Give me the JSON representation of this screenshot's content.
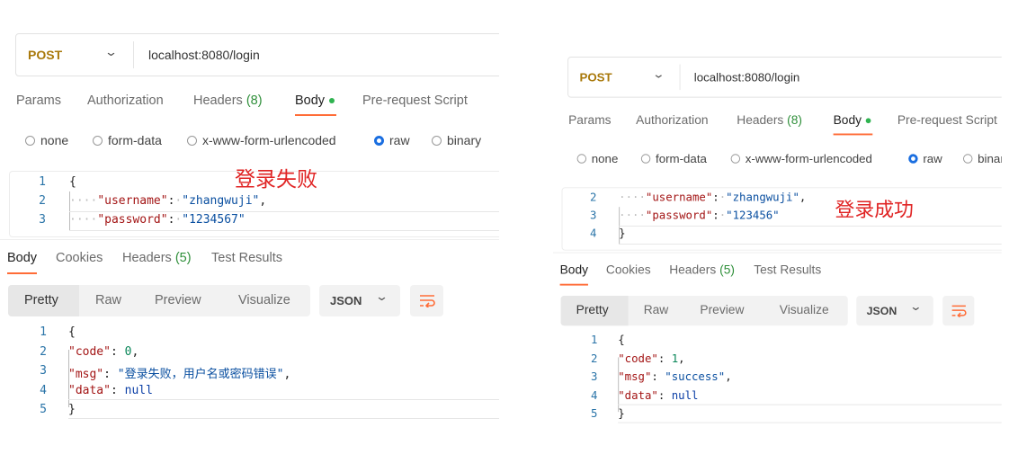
{
  "colors": {
    "accent": "#ff6c37",
    "method": "#a9790b",
    "annotation": "#e02424",
    "radio_selected": "#1a6ee0"
  },
  "panels": [
    {
      "method": "POST",
      "url": "localhost:8080/login",
      "request_tabs": [
        {
          "label": "Params"
        },
        {
          "label": "Authorization"
        },
        {
          "label": "Headers",
          "badge": "(8)"
        },
        {
          "label": "Body",
          "active": true,
          "dot": true
        },
        {
          "label": "Pre-request Script"
        }
      ],
      "body_types": [
        {
          "label": "none"
        },
        {
          "label": "form-data"
        },
        {
          "label": "x-www-form-urlencoded"
        },
        {
          "label": "raw",
          "selected": true
        },
        {
          "label": "binary"
        }
      ],
      "annotation": "登录失败",
      "request_lines": [
        {
          "n": "1",
          "tokens": [
            {
              "t": "{",
              "c": "p"
            }
          ]
        },
        {
          "n": "2",
          "tokens": [
            {
              "t": "····",
              "c": "w"
            },
            {
              "t": "\"username\"",
              "c": "k"
            },
            {
              "t": ":",
              "c": "p"
            },
            {
              "t": "·",
              "c": "w"
            },
            {
              "t": "\"zhangwuji\"",
              "c": "s"
            },
            {
              "t": ",",
              "c": "p"
            }
          ]
        },
        {
          "n": "3",
          "tokens": [
            {
              "t": "····",
              "c": "w"
            },
            {
              "t": "\"password\"",
              "c": "k"
            },
            {
              "t": ":",
              "c": "p"
            },
            {
              "t": "·",
              "c": "w"
            },
            {
              "t": "\"1234567\"",
              "c": "s"
            }
          ]
        }
      ],
      "response_tabs": [
        {
          "label": "Body",
          "active": true
        },
        {
          "label": "Cookies"
        },
        {
          "label": "Headers",
          "badge": "(5)"
        },
        {
          "label": "Test Results"
        }
      ],
      "view_modes": [
        "Pretty",
        "Raw",
        "Preview",
        "Visualize"
      ],
      "format": "JSON",
      "response_lines": [
        {
          "n": "1",
          "tokens": [
            {
              "t": "{",
              "c": "p"
            }
          ]
        },
        {
          "n": "2",
          "tokens": [
            {
              "t": "    ",
              "c": "w"
            },
            {
              "t": "\"code\"",
              "c": "k"
            },
            {
              "t": ": ",
              "c": "p"
            },
            {
              "t": "0",
              "c": "n"
            },
            {
              "t": ",",
              "c": "p"
            }
          ]
        },
        {
          "n": "3",
          "tokens": [
            {
              "t": "    ",
              "c": "w"
            },
            {
              "t": "\"msg\"",
              "c": "k"
            },
            {
              "t": ": ",
              "c": "p"
            },
            {
              "t": "\"登录失败，用户名或密码错误\"",
              "c": "s"
            },
            {
              "t": ",",
              "c": "p"
            }
          ]
        },
        {
          "n": "4",
          "tokens": [
            {
              "t": "    ",
              "c": "w"
            },
            {
              "t": "\"data\"",
              "c": "k"
            },
            {
              "t": ": ",
              "c": "p"
            },
            {
              "t": "null",
              "c": "nl"
            }
          ]
        },
        {
          "n": "5",
          "tokens": [
            {
              "t": "}",
              "c": "p"
            }
          ]
        }
      ]
    },
    {
      "method": "POST",
      "url": "localhost:8080/login",
      "request_tabs": [
        {
          "label": "Params"
        },
        {
          "label": "Authorization"
        },
        {
          "label": "Headers",
          "badge": "(8)"
        },
        {
          "label": "Body",
          "active": true,
          "dot": true
        },
        {
          "label": "Pre-request Script"
        }
      ],
      "body_types": [
        {
          "label": "none"
        },
        {
          "label": "form-data"
        },
        {
          "label": "x-www-form-urlencoded"
        },
        {
          "label": "raw",
          "selected": true
        },
        {
          "label": "binary"
        }
      ],
      "annotation": "登录成功",
      "request_lines": [
        {
          "n": "2",
          "tokens": [
            {
              "t": "····",
              "c": "w"
            },
            {
              "t": "\"username\"",
              "c": "k"
            },
            {
              "t": ":",
              "c": "p"
            },
            {
              "t": "·",
              "c": "w"
            },
            {
              "t": "\"zhangwuji\"",
              "c": "s"
            },
            {
              "t": ",",
              "c": "p"
            }
          ]
        },
        {
          "n": "3",
          "tokens": [
            {
              "t": "····",
              "c": "w"
            },
            {
              "t": "\"password\"",
              "c": "k"
            },
            {
              "t": ":",
              "c": "p"
            },
            {
              "t": "·",
              "c": "w"
            },
            {
              "t": "\"123456\"",
              "c": "s"
            }
          ]
        },
        {
          "n": "4",
          "tokens": [
            {
              "t": "}",
              "c": "p"
            }
          ]
        }
      ],
      "response_tabs": [
        {
          "label": "Body",
          "active": true
        },
        {
          "label": "Cookies"
        },
        {
          "label": "Headers",
          "badge": "(5)"
        },
        {
          "label": "Test Results"
        }
      ],
      "view_modes": [
        "Pretty",
        "Raw",
        "Preview",
        "Visualize"
      ],
      "format": "JSON",
      "response_lines": [
        {
          "n": "1",
          "tokens": [
            {
              "t": "{",
              "c": "p"
            }
          ]
        },
        {
          "n": "2",
          "tokens": [
            {
              "t": "    ",
              "c": "w"
            },
            {
              "t": "\"code\"",
              "c": "k"
            },
            {
              "t": ": ",
              "c": "p"
            },
            {
              "t": "1",
              "c": "n"
            },
            {
              "t": ",",
              "c": "p"
            }
          ]
        },
        {
          "n": "3",
          "tokens": [
            {
              "t": "    ",
              "c": "w"
            },
            {
              "t": "\"msg\"",
              "c": "k"
            },
            {
              "t": ": ",
              "c": "p"
            },
            {
              "t": "\"success\"",
              "c": "s"
            },
            {
              "t": ",",
              "c": "p"
            }
          ]
        },
        {
          "n": "4",
          "tokens": [
            {
              "t": "    ",
              "c": "w"
            },
            {
              "t": "\"data\"",
              "c": "k"
            },
            {
              "t": ": ",
              "c": "p"
            },
            {
              "t": "null",
              "c": "nl"
            }
          ]
        },
        {
          "n": "5",
          "tokens": [
            {
              "t": "}",
              "c": "p"
            }
          ]
        }
      ]
    }
  ]
}
